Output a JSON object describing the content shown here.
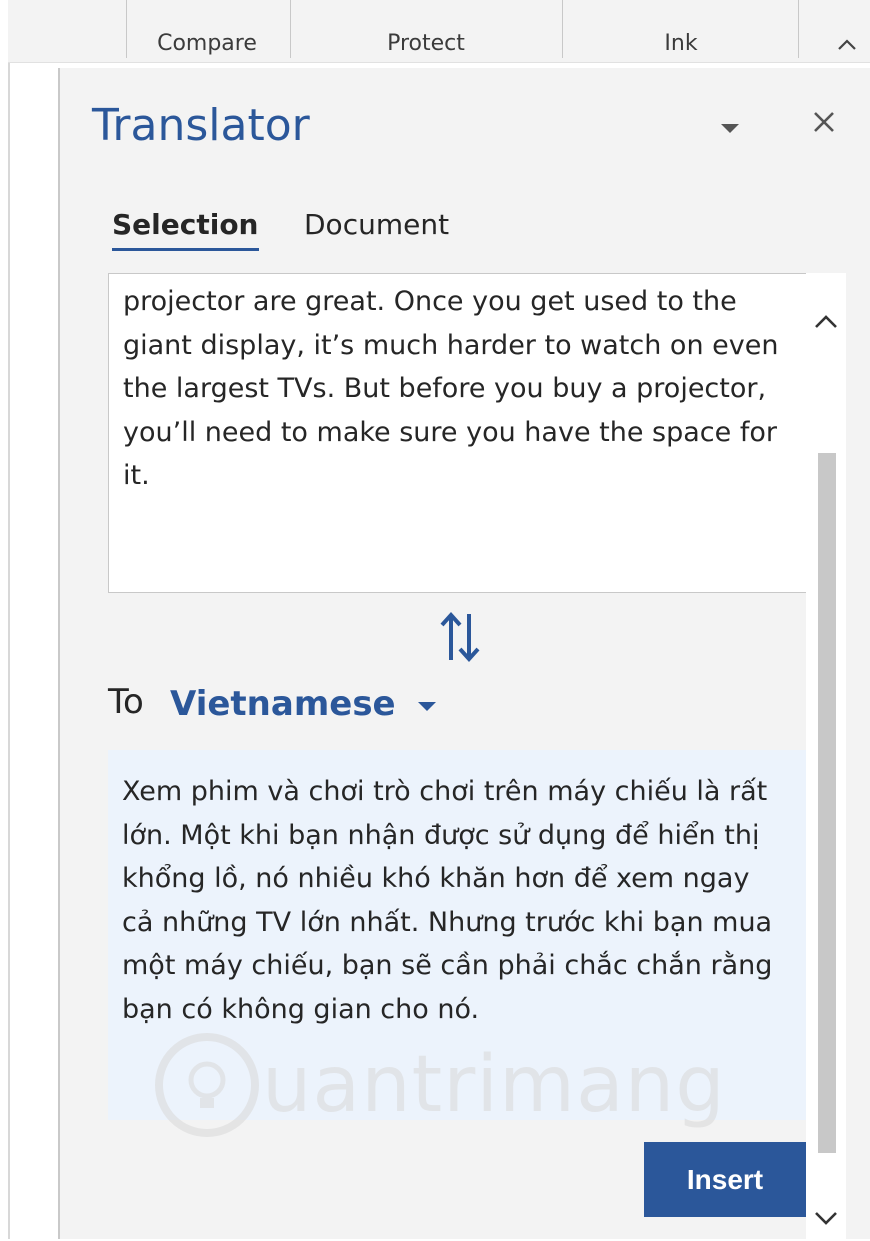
{
  "ribbon": {
    "groups": [
      "Compare",
      "Protect",
      "Ink"
    ]
  },
  "pane": {
    "title": "Translator",
    "tabs": [
      "Selection",
      "Document"
    ],
    "source_text": "projector are great. Once you get used to the giant display, it’s much harder to watch on even the largest TVs. But before you buy a projector, you’ll need to make sure you have the space for it.",
    "to_label": "To",
    "target_language": "Vietnamese",
    "translated_text": "Xem phim và chơi trò chơi trên máy chiếu là rất lớn. Một khi bạn nhận được sử dụng để hiển thị khổng lồ, nó nhiều khó khăn hơn để xem ngay cả những TV lớn nhất. Nhưng trước khi bạn mua một máy chiếu, bạn sẽ cần phải chắc chắn rằng bạn có không gian cho nó.",
    "insert_label": "Insert"
  },
  "watermark": "uantrimang",
  "colors": {
    "accent": "#2b579a",
    "pane_bg": "#f3f3f3",
    "translation_bg": "#ecf3fc"
  }
}
